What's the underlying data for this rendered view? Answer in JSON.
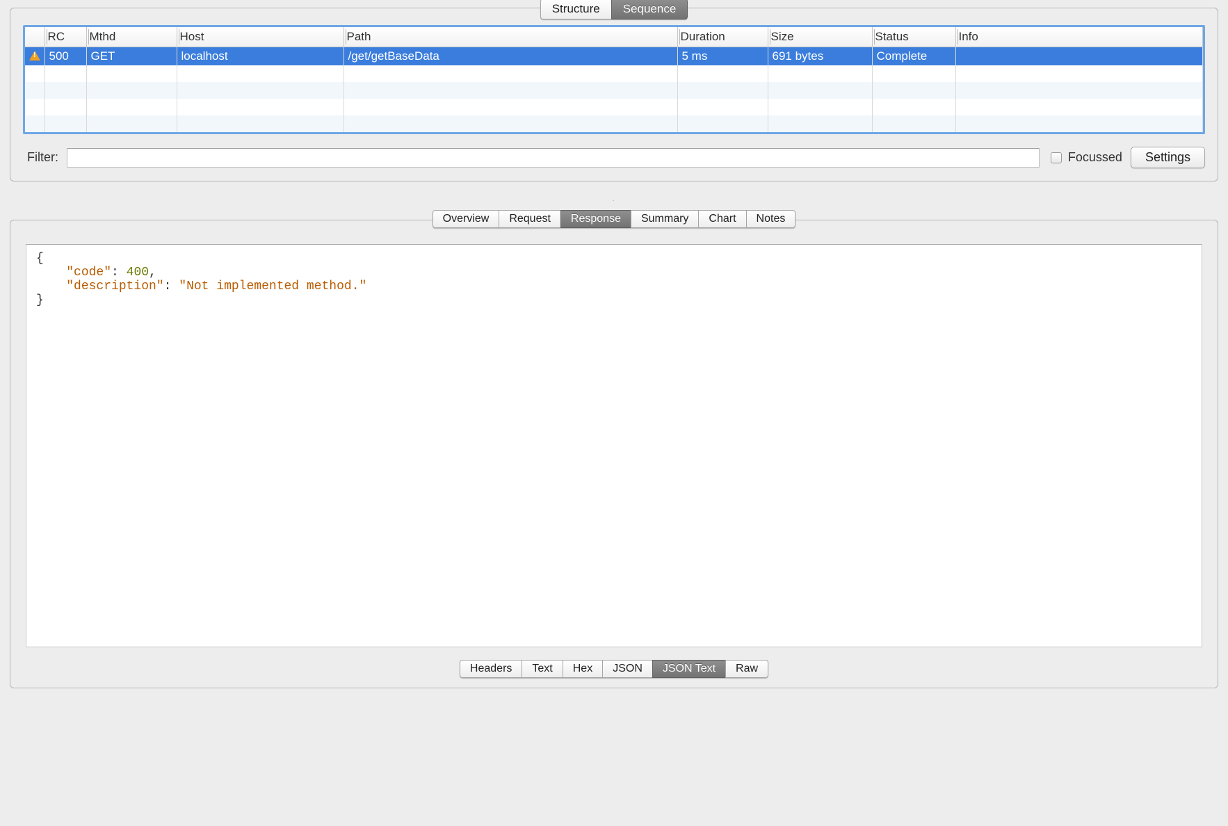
{
  "top_tabs": {
    "structure": "Structure",
    "sequence": "Sequence",
    "active": "sequence"
  },
  "columns": {
    "icon": "",
    "rc": "RC",
    "mthd": "Mthd",
    "host": "Host",
    "path": "Path",
    "duration": "Duration",
    "size": "Size",
    "status": "Status",
    "info": "Info"
  },
  "rows": [
    {
      "icon": "warn",
      "rc": "500",
      "mthd": "GET",
      "host": "localhost",
      "path": "/get/getBaseData",
      "duration": "5 ms",
      "size": "691 bytes",
      "status": "Complete",
      "info": ""
    }
  ],
  "filter": {
    "label": "Filter:",
    "value": "",
    "focussed_label": "Focussed",
    "settings_label": "Settings"
  },
  "detail_tabs": {
    "overview": "Overview",
    "request": "Request",
    "response": "Response",
    "summary": "Summary",
    "chart": "Chart",
    "notes": "Notes",
    "active": "response"
  },
  "response_body": {
    "brace_open": "{",
    "k_code": "\"code\"",
    "colon": ": ",
    "v_code": "400",
    "comma": ",",
    "k_desc": "\"description\"",
    "v_desc": "\"Not implemented method.\"",
    "brace_close": "}"
  },
  "sub_tabs": {
    "headers": "Headers",
    "text": "Text",
    "hex": "Hex",
    "json": "JSON",
    "json_text": "JSON Text",
    "raw": "Raw",
    "active": "json_text"
  }
}
